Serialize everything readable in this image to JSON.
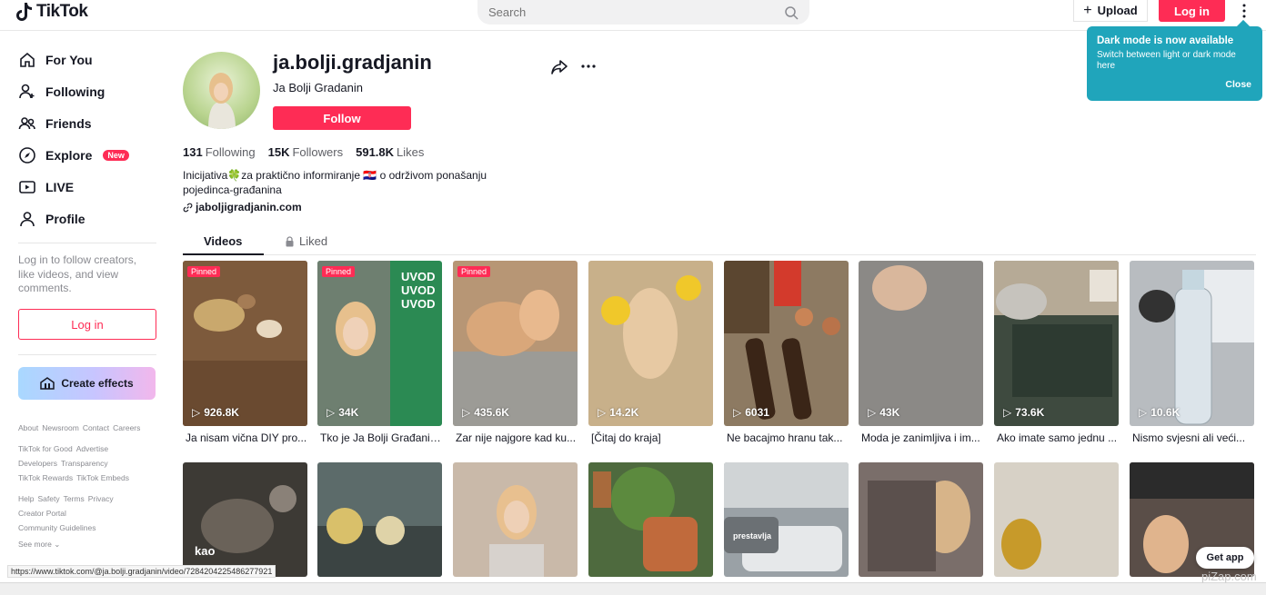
{
  "header": {
    "brand": "TikTok",
    "search_placeholder": "Search",
    "upload_label": "Upload",
    "login_label": "Log in"
  },
  "sidebar": {
    "items": [
      {
        "label": "For You",
        "icon": "home-icon"
      },
      {
        "label": "Following",
        "icon": "person-plus-icon"
      },
      {
        "label": "Friends",
        "icon": "friends-icon"
      },
      {
        "label": "Explore",
        "icon": "compass-icon",
        "badge": "New"
      },
      {
        "label": "LIVE",
        "icon": "live-icon"
      },
      {
        "label": "Profile",
        "icon": "user-icon"
      }
    ],
    "login_hint": "Log in to follow creators, like videos, and view comments.",
    "login_button": "Log in",
    "create_effects": "Create effects",
    "footer_lines": [
      [
        "About",
        "Newsroom",
        "Contact",
        "Careers"
      ],
      [
        "TikTok for Good",
        "Advertise"
      ],
      [
        "Developers",
        "Transparency"
      ],
      [
        "TikTok Rewards",
        "TikTok Embeds"
      ],
      [
        "Help",
        "Safety",
        "Terms",
        "Privacy"
      ],
      [
        "Creator Portal"
      ],
      [
        "Community Guidelines"
      ]
    ],
    "see_more": "See more"
  },
  "profile": {
    "username": "ja.bolji.gradjanin",
    "nickname": "Ja Bolji Gradanin",
    "follow_label": "Follow",
    "stats": {
      "following_count": "131",
      "following_label": "Following",
      "followers_count": "15K",
      "followers_label": "Followers",
      "likes_count": "591.8K",
      "likes_label": "Likes"
    },
    "bio_line1": "Inicijativa🍀za praktično informiranje 🇭🇷 o održivom ponašanju",
    "bio_line2": "pojedinca-građanina",
    "link": "jaboljigradjanin.com"
  },
  "tabs": [
    {
      "label": "Videos",
      "active": true
    },
    {
      "label": "Liked",
      "active": false,
      "icon": "lock-icon"
    }
  ],
  "videos_row1": [
    {
      "views": "926.8K",
      "title": "Ja nisam vična DIY pro...",
      "pinned": "Pinned",
      "bg": "#8a6a4a"
    },
    {
      "views": "34K",
      "title": "Tko je Ja Bolji Građanin...",
      "pinned": "Pinned",
      "bg": "#2f8a55",
      "overlay": "UVOD UVOD UVOD"
    },
    {
      "views": "435.6K",
      "title": "Zar nije najgore kad ku...",
      "pinned": "Pinned",
      "bg": "#b08d6c"
    },
    {
      "views": "14.2K",
      "title": "[Čitaj do kraja]",
      "bg": "#c9b48a"
    },
    {
      "views": "6031",
      "title": "Ne bacajmo hranu tak...",
      "bg": "#6b4a35"
    },
    {
      "views": "43K",
      "title": "Moda je zanimljiva i im...",
      "bg": "#8d8b88"
    },
    {
      "views": "73.6K",
      "title": "Ako imate samo jednu ...",
      "bg": "#4b5a4c"
    },
    {
      "views": "10.6K",
      "title": "Nismo svjesni ali veći...",
      "bg": "#a7adb3"
    }
  ],
  "videos_row2": [
    {
      "bg": "#3d3a35",
      "overlay": "kao"
    },
    {
      "bg": "#5c6b6a"
    },
    {
      "bg": "#c9b9a9"
    },
    {
      "bg": "#4e6a3e"
    },
    {
      "bg": "#8a8f95",
      "overlay": "prestavlja"
    },
    {
      "bg": "#7a6e6a"
    },
    {
      "bg": "#d7d1c6"
    },
    {
      "bg": "#5a4e48"
    }
  ],
  "tooltip": {
    "title": "Dark mode is now available",
    "body": "Switch between light or dark mode here",
    "close": "Close"
  },
  "get_app": "Get app",
  "status_url": "https://www.tiktok.com/@ja.bolji.gradjanin/video/7284204225486277921",
  "watermark": "piZap.com",
  "colors": {
    "accent": "#fe2c55",
    "tooltip": "#20a5bb"
  }
}
